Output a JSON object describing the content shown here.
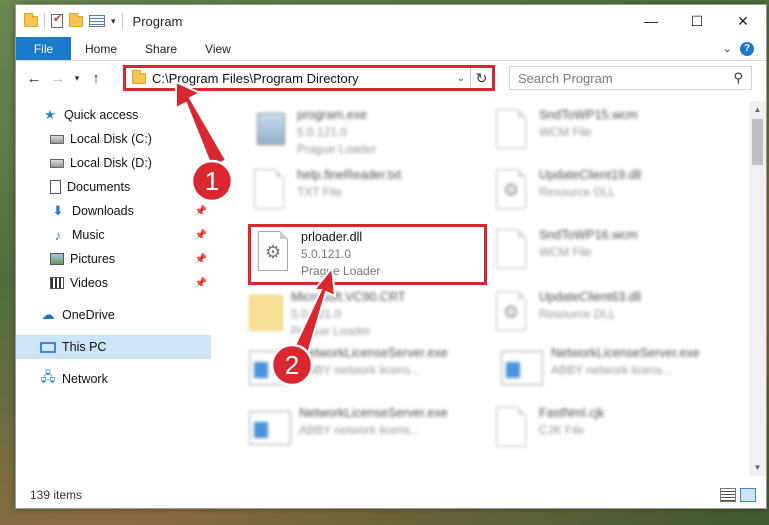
{
  "window": {
    "title": "Program",
    "controls": [
      "minimize-icon",
      "maximize-icon",
      "close-icon"
    ]
  },
  "ribbon": {
    "file": "File",
    "tabs": [
      "Home",
      "Share",
      "View"
    ]
  },
  "nav": {
    "address": "C:\\Program Files\\Program Directory",
    "search_placeholder": "Search Program"
  },
  "sidebar": {
    "items": [
      {
        "label": "Quick access",
        "icon": "star-icon"
      },
      {
        "label": "Local Disk (C:)",
        "icon": "drive-icon"
      },
      {
        "label": "Local Disk (D:)",
        "icon": "drive-icon"
      },
      {
        "label": "Documents",
        "icon": "documents-icon"
      },
      {
        "label": "Downloads",
        "icon": "downloads-icon"
      },
      {
        "label": "Music",
        "icon": "music-icon"
      },
      {
        "label": "Pictures",
        "icon": "pictures-icon"
      },
      {
        "label": "Videos",
        "icon": "videos-icon"
      },
      {
        "label": "OneDrive",
        "icon": "cloud-icon"
      },
      {
        "label": "This PC",
        "icon": "computer-icon"
      },
      {
        "label": "Network",
        "icon": "network-icon"
      }
    ]
  },
  "files": [
    {
      "name": "program.exe",
      "line2": "5.0.121.0",
      "line3": "Prague Loader"
    },
    {
      "name": "SndToWP15.wcm",
      "line2": "WCM File",
      "line3": ""
    },
    {
      "name": "help.fineReader.txt",
      "line2": "TXT File",
      "line3": ""
    },
    {
      "name": "UpdateClient19.dll",
      "line2": "Resource DLL",
      "line3": ""
    },
    {
      "name": "prloader.dll",
      "line2": "5.0.121.0",
      "line3": "Prague Loader"
    },
    {
      "name": "SndToWP16.wcm",
      "line2": "WCM File",
      "line3": ""
    },
    {
      "name": "Microsoft.VC90.CRT",
      "line2": "5.0.121.0",
      "line3": "Prague Loader"
    },
    {
      "name": "UpdateClient63.dll",
      "line2": "Resource DLL",
      "line3": ""
    },
    {
      "name": "NetworkLicenseServer.exe",
      "line2": "ABBY network licens...",
      "line3": ""
    },
    {
      "name": "NetworkLicenseServer.exe",
      "line2": "ABBY network licens...",
      "line3": ""
    },
    {
      "name": "NetworkLicenseServer.exe",
      "line2": "ABBY network licens...",
      "line3": ""
    },
    {
      "name": "FastNml.cjk",
      "line2": "CJK File",
      "line3": ""
    }
  ],
  "status": {
    "count": "139 items"
  },
  "annotations": {
    "badge1": "1",
    "badge2": "2",
    "color": "#d8272f"
  }
}
